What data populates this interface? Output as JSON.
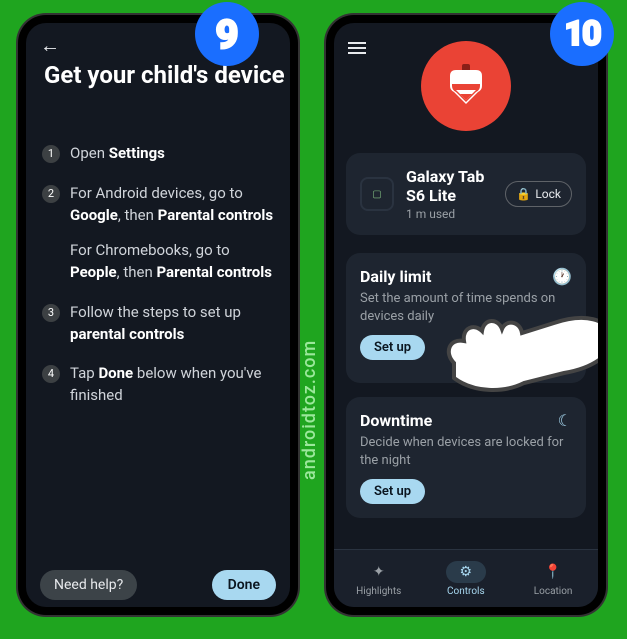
{
  "watermark": "androidtoz.com",
  "badges": {
    "left": "9",
    "right": "10"
  },
  "left_screen": {
    "title": "Get your child's device",
    "steps": [
      {
        "num": "1",
        "html": "Open <b>Settings</b>"
      },
      {
        "num": "2",
        "html": "For Android devices, go to <b>Google</b>, then <b>Parental controls</b><div class='step-sub'>For Chromebooks, go to <b>People</b>, then <b>Parental controls</b></div>"
      },
      {
        "num": "3",
        "html": "Follow the steps to set up <b>parental controls</b>"
      },
      {
        "num": "4",
        "html": "Tap <b>Done</b> below when you've finished"
      }
    ],
    "need_help": "Need help?",
    "done": "Done"
  },
  "right_screen": {
    "device": {
      "name": "Galaxy Tab S6 Lite",
      "usage": "1 m used",
      "lock_label": "Lock"
    },
    "daily_limit": {
      "title": "Daily limit",
      "desc": "Set the amount of time spends on devices daily",
      "button": "Set up"
    },
    "downtime": {
      "title": "Downtime",
      "desc": "Decide when devices are locked for the night",
      "button": "Set up"
    },
    "nav": {
      "highlights": "Highlights",
      "controls": "Controls",
      "location": "Location"
    }
  }
}
